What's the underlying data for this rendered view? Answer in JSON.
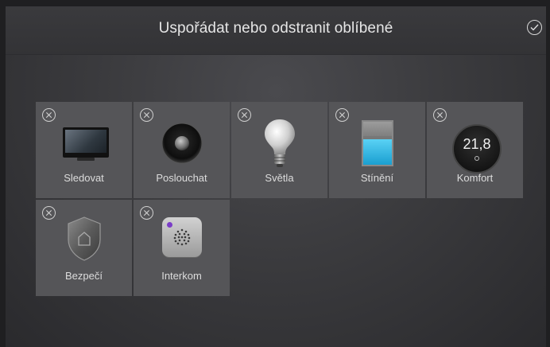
{
  "header": {
    "title": "Uspořádat nebo odstranit oblíbené",
    "confirm_icon": "check-circle-icon"
  },
  "favorites": [
    {
      "label": "Sledovat",
      "icon": "tv-icon"
    },
    {
      "label": "Poslouchat",
      "icon": "speaker-icon"
    },
    {
      "label": "Světla",
      "icon": "lightbulb-icon"
    },
    {
      "label": "Stínění",
      "icon": "shade-icon"
    },
    {
      "label": "Komfort",
      "icon": "thermostat-icon",
      "value": "21,8"
    },
    {
      "label": "Bezpečí",
      "icon": "shield-house-icon"
    },
    {
      "label": "Interkom",
      "icon": "intercom-icon"
    }
  ],
  "colors": {
    "tile": "#555558",
    "shade_open": "#3fbde8",
    "intercom_led": "#7b3dc8"
  }
}
